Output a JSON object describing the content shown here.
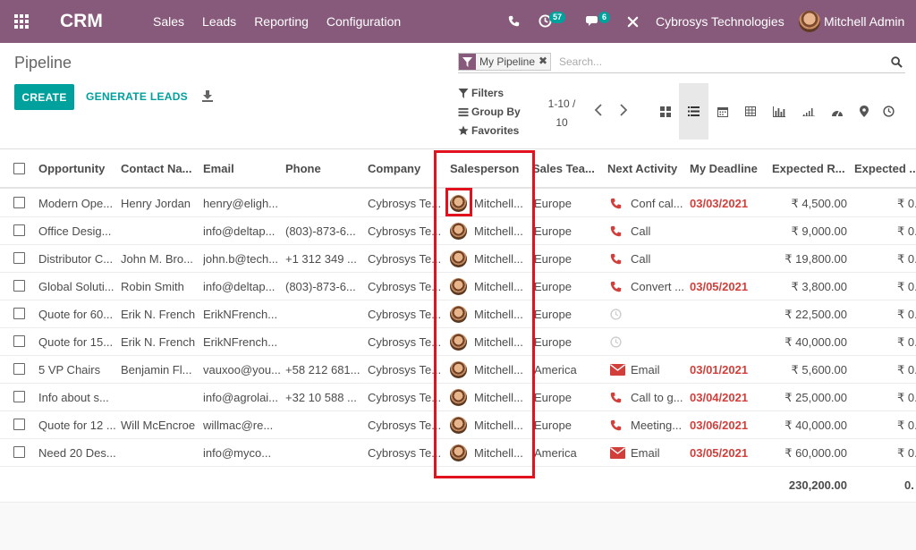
{
  "navbar": {
    "brand": "CRM",
    "menu": [
      "Sales",
      "Leads",
      "Reporting",
      "Configuration"
    ],
    "activity_count": "57",
    "messages_count": "6",
    "company": "Cybrosys Technologies",
    "user": "Mitchell Admin"
  },
  "control": {
    "title": "Pipeline",
    "create_label": "CREATE",
    "generate_label": "GENERATE LEADS",
    "facet_label": "My Pipeline",
    "search_placeholder": "Search...",
    "filters_label": "Filters",
    "groupby_label": "Group By",
    "favorites_label": "Favorites",
    "pager_value": "1-10 /",
    "pager_total": "10"
  },
  "table": {
    "headers": [
      "Opportunity",
      "Contact Na...",
      "Email",
      "Phone",
      "Company",
      "Salesperson",
      "Sales Tea...",
      "Next Activity",
      "My Deadline",
      "Expected R...",
      "Expected ..."
    ],
    "rows": [
      {
        "opportunity": "Modern Ope...",
        "contact": "Henry Jordan",
        "email": "henry@eligh...",
        "phone": "",
        "company": "Cybrosys Te...",
        "salesperson": "Mitchell...",
        "team": "Europe",
        "activity_icon": "phone-icon",
        "activity": "Conf cal...",
        "deadline": "03/03/2021",
        "revenue": "₹ 4,500.00",
        "expected": "₹ 0."
      },
      {
        "opportunity": "Office Desig...",
        "contact": "",
        "email": "info@deltap...",
        "phone": "(803)-873-6...",
        "company": "Cybrosys Te...",
        "salesperson": "Mitchell...",
        "team": "Europe",
        "activity_icon": "phone-icon",
        "activity": "Call",
        "deadline": "",
        "revenue": "₹ 9,000.00",
        "expected": "₹ 0."
      },
      {
        "opportunity": "Distributor C...",
        "contact": "John M. Bro...",
        "email": "john.b@tech...",
        "phone": "+1 312 349 ...",
        "company": "Cybrosys Te...",
        "salesperson": "Mitchell...",
        "team": "Europe",
        "activity_icon": "phone-icon",
        "activity": "Call",
        "deadline": "",
        "revenue": "₹ 19,800.00",
        "expected": "₹ 0."
      },
      {
        "opportunity": "Global Soluti...",
        "contact": "Robin Smith",
        "email": "info@deltap...",
        "phone": "(803)-873-6...",
        "company": "Cybrosys Te...",
        "salesperson": "Mitchell...",
        "team": "Europe",
        "activity_icon": "phone-icon",
        "activity": "Convert ...",
        "deadline": "03/05/2021",
        "revenue": "₹ 3,800.00",
        "expected": "₹ 0."
      },
      {
        "opportunity": "Quote for 60...",
        "contact": "Erik N. French",
        "email": "ErikNFrench...",
        "phone": "",
        "company": "Cybrosys Te...",
        "salesperson": "Mitchell...",
        "team": "Europe",
        "activity_icon": "clock-icon",
        "activity": "",
        "deadline": "",
        "revenue": "₹ 22,500.00",
        "expected": "₹ 0."
      },
      {
        "opportunity": "Quote for 15...",
        "contact": "Erik N. French",
        "email": "ErikNFrench...",
        "phone": "",
        "company": "Cybrosys Te...",
        "salesperson": "Mitchell...",
        "team": "Europe",
        "activity_icon": "clock-icon",
        "activity": "",
        "deadline": "",
        "revenue": "₹ 40,000.00",
        "expected": "₹ 0."
      },
      {
        "opportunity": "5 VP Chairs",
        "contact": "Benjamin Fl...",
        "email": "vauxoo@you...",
        "phone": "+58 212 681...",
        "company": "Cybrosys Te...",
        "salesperson": "Mitchell...",
        "team": "America",
        "activity_icon": "envelope-icon",
        "activity": "Email",
        "deadline": "03/01/2021",
        "revenue": "₹ 5,600.00",
        "expected": "₹ 0."
      },
      {
        "opportunity": "Info about s...",
        "contact": "",
        "email": "info@agrolai...",
        "phone": "+32 10 588 ...",
        "company": "Cybrosys Te...",
        "salesperson": "Mitchell...",
        "team": "Europe",
        "activity_icon": "phone-icon",
        "activity": "Call to g...",
        "deadline": "03/04/2021",
        "revenue": "₹ 25,000.00",
        "expected": "₹ 0."
      },
      {
        "opportunity": "Quote for 12 ...",
        "contact": "Will McEncroe",
        "email": "willmac@re...",
        "phone": "",
        "company": "Cybrosys Te...",
        "salesperson": "Mitchell...",
        "team": "Europe",
        "activity_icon": "phone-icon",
        "activity": "Meeting...",
        "deadline": "03/06/2021",
        "revenue": "₹ 40,000.00",
        "expected": "₹ 0."
      },
      {
        "opportunity": "Need 20 Des...",
        "contact": "",
        "email": "info@myco...",
        "phone": "",
        "company": "Cybrosys Te...",
        "salesperson": "Mitchell...",
        "team": "America",
        "activity_icon": "envelope-icon",
        "activity": "Email",
        "deadline": "03/05/2021",
        "revenue": "₹ 60,000.00",
        "expected": "₹ 0."
      }
    ],
    "total_revenue": "230,200.00",
    "total_expected": "0."
  },
  "colors": {
    "navbar": "#875a7b",
    "primary": "#00a09d",
    "deadline": "#d23f3a",
    "highlight": "#e1121e"
  }
}
